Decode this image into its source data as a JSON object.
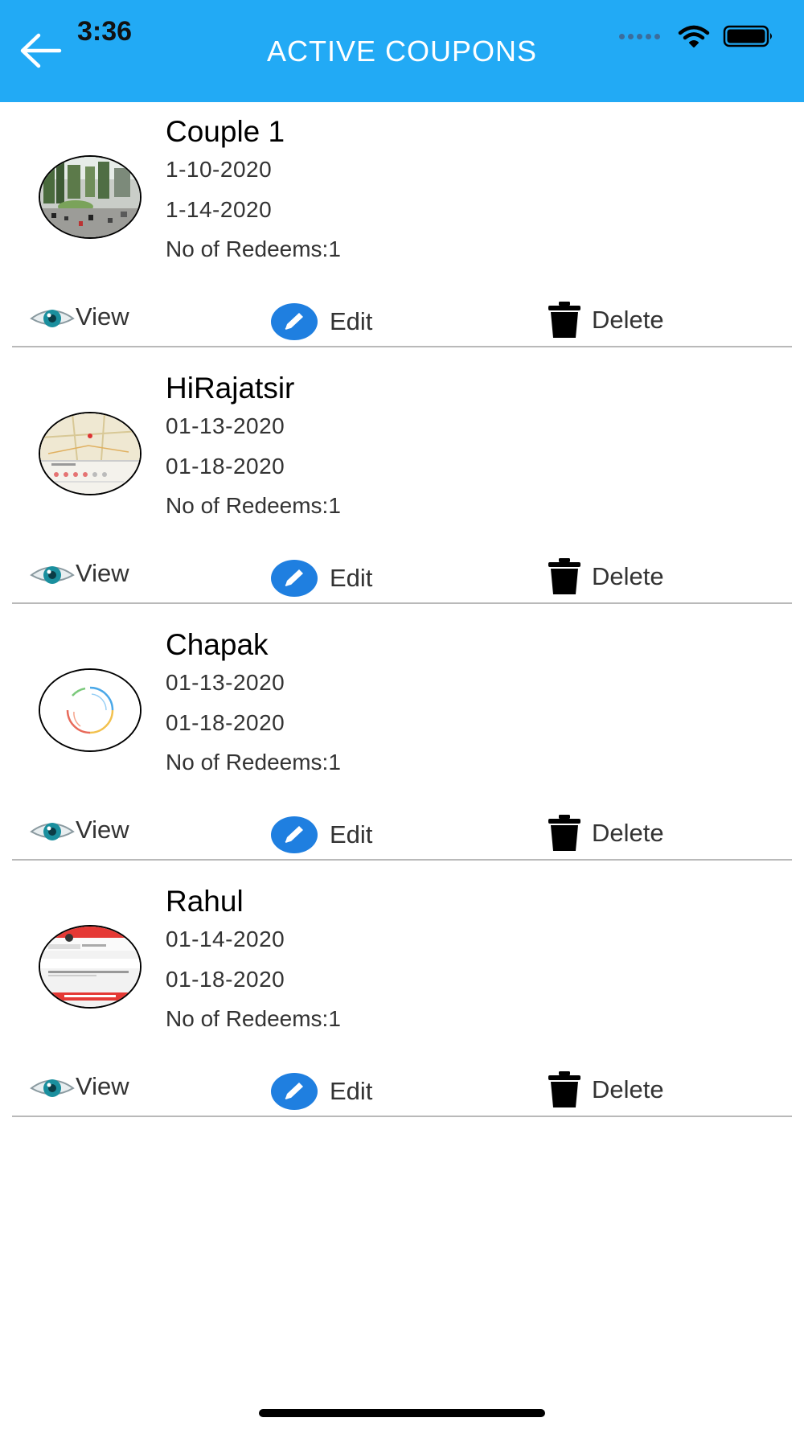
{
  "status_bar": {
    "time": "3:36"
  },
  "header": {
    "title": "ACTIVE COUPONS"
  },
  "actions": {
    "view_label": "View",
    "edit_label": "Edit",
    "delete_label": "Delete"
  },
  "coupons": [
    {
      "title": "Couple 1",
      "start_date": "1-10-2020",
      "end_date": "1-14-2020",
      "redeems": "No of Redeems:1",
      "thumbnail": "street-photo"
    },
    {
      "title": "HiRajatsir",
      "start_date": "01-13-2020",
      "end_date": "01-18-2020",
      "redeems": "No of Redeems:1",
      "thumbnail": "map-screenshot"
    },
    {
      "title": "Chapak",
      "start_date": "01-13-2020",
      "end_date": "01-18-2020",
      "redeems": "No of Redeems:1",
      "thumbnail": "loading-ring"
    },
    {
      "title": "Rahul",
      "start_date": "01-14-2020",
      "end_date": "01-18-2020",
      "redeems": "No of Redeems:1",
      "thumbnail": "app-screenshot"
    }
  ],
  "colors": {
    "header_bg": "#22aaf5",
    "edit_icon": "#1f7fe0",
    "divider": "#b9b9b9",
    "eye_iris": "#1a8f9e"
  }
}
